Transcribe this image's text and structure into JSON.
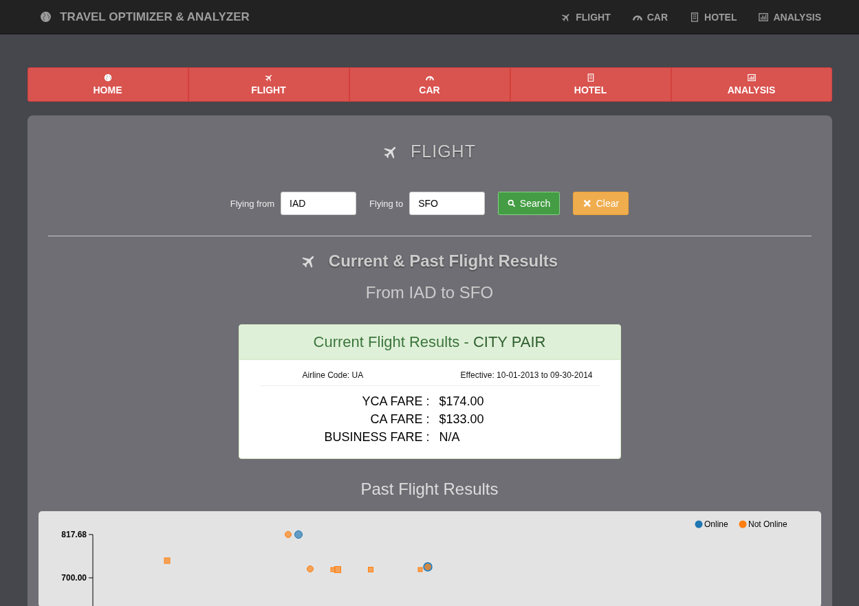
{
  "navbar": {
    "brand": "TRAVEL OPTIMIZER & ANALYZER",
    "links": [
      {
        "label": "FLIGHT"
      },
      {
        "label": "CAR"
      },
      {
        "label": "HOTEL"
      },
      {
        "label": "ANALYSIS"
      }
    ]
  },
  "tiles": [
    {
      "label": "HOME"
    },
    {
      "label": "FLIGHT"
    },
    {
      "label": "CAR"
    },
    {
      "label": "HOTEL"
    },
    {
      "label": "ANALYSIS"
    }
  ],
  "panel": {
    "title": "FLIGHT",
    "form": {
      "from_label": "Flying from",
      "from_value": "IAD",
      "to_label": "Flying to",
      "to_value": "SFO",
      "search": "Search",
      "clear": "Clear"
    },
    "results_title": "Current & Past Flight Results",
    "route": "From IAD to SFO",
    "current": {
      "heading": "Current Flight Results - **CITY PAIR**",
      "airline": "Airline Code: UA",
      "effective": "Effective: 10-01-2013 to 09-30-2014",
      "fares": [
        {
          "label": "YCA FARE :",
          "value": "$174.00"
        },
        {
          "label": "CA FARE :",
          "value": "$133.00"
        },
        {
          "label": "BUSINESS FARE :",
          "value": "N/A"
        }
      ]
    },
    "past_title": "Past Flight Results",
    "past_chart": {
      "y_labels": [
        "817.68",
        "700.00"
      ],
      "legend": [
        {
          "label": "Online",
          "color": "#1f77b4"
        },
        {
          "label": "Not Online",
          "color": "#ff7f0e"
        }
      ]
    }
  }
}
